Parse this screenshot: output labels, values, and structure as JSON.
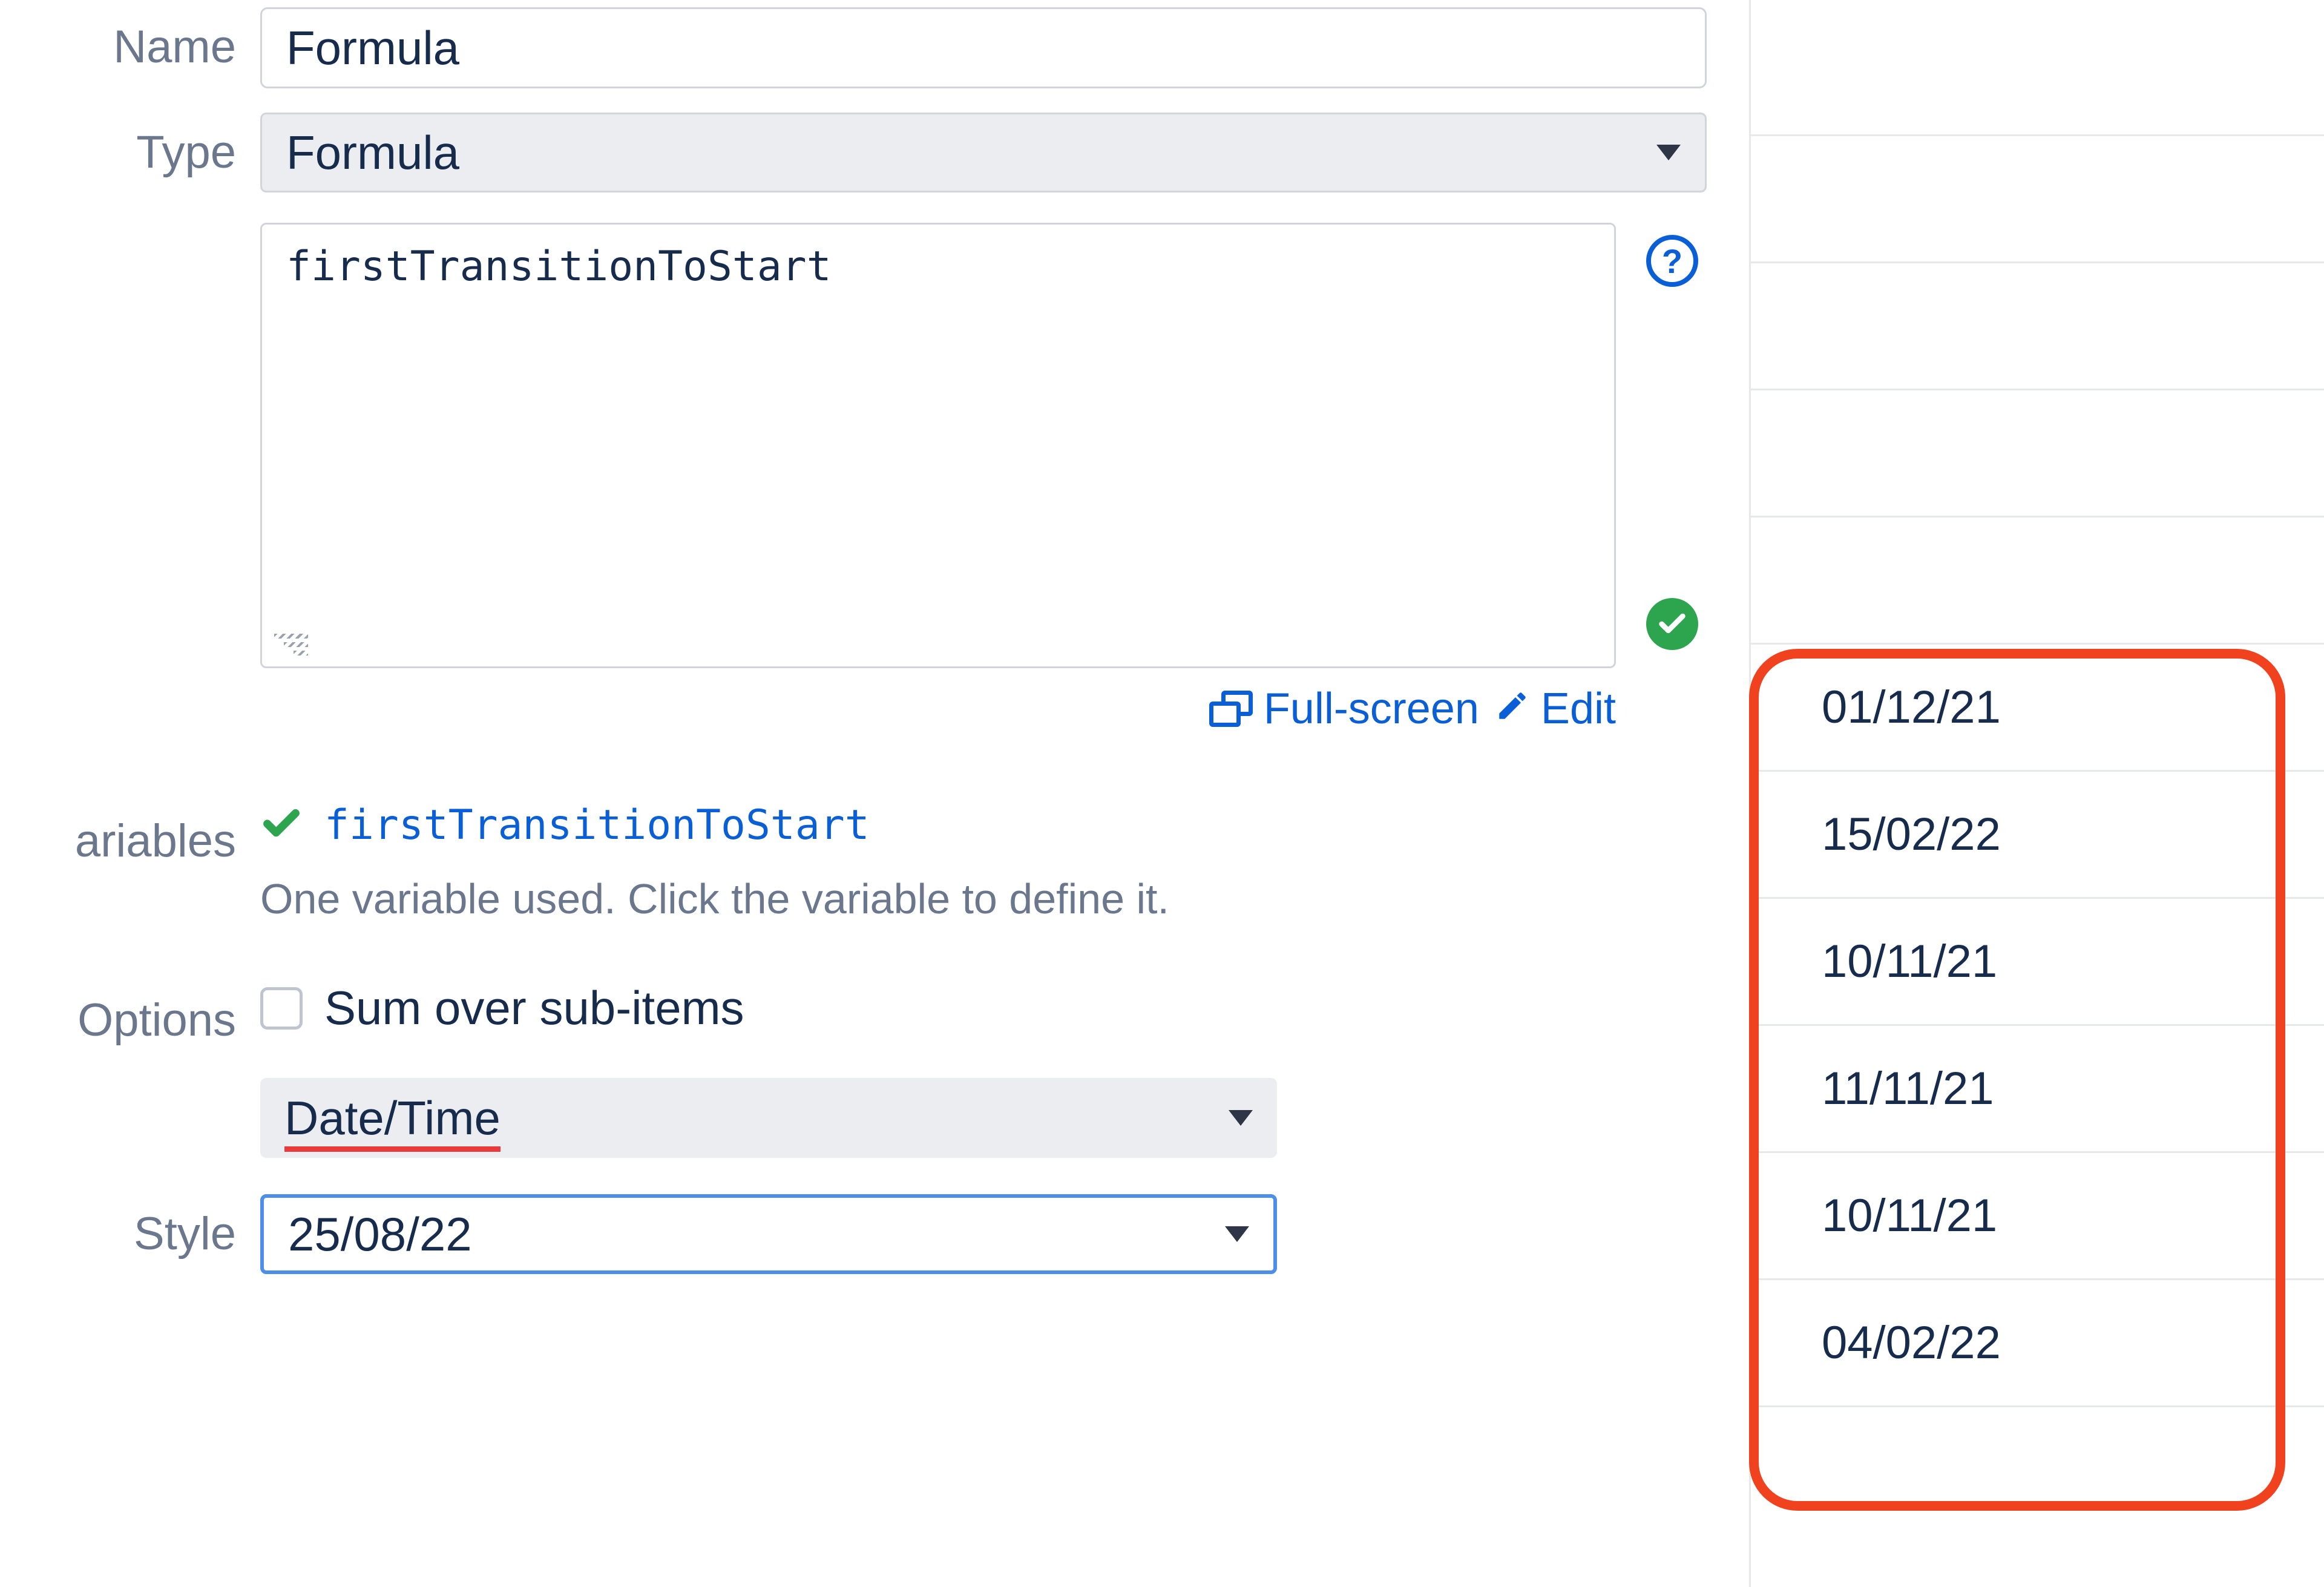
{
  "form": {
    "name": {
      "label": "Name",
      "value": "Formula"
    },
    "type": {
      "label": "Type",
      "value": "Formula"
    },
    "formula": {
      "text": "firstTransitionToStart"
    },
    "links": {
      "fullscreen": "Full-screen",
      "edit": "Edit"
    },
    "variables": {
      "label": "ariables",
      "name": "firstTransitionToStart",
      "hint": "One variable used. Click the variable to define it."
    },
    "options": {
      "label": "Options",
      "sum_label": "Sum over sub-items",
      "datetime_value": "Date/Time"
    },
    "style": {
      "label": "Style",
      "value": "25/08/22"
    }
  },
  "dates": [
    "01/12/21",
    "15/02/22",
    "10/11/21",
    "11/11/21",
    "10/11/21",
    "04/02/22"
  ]
}
